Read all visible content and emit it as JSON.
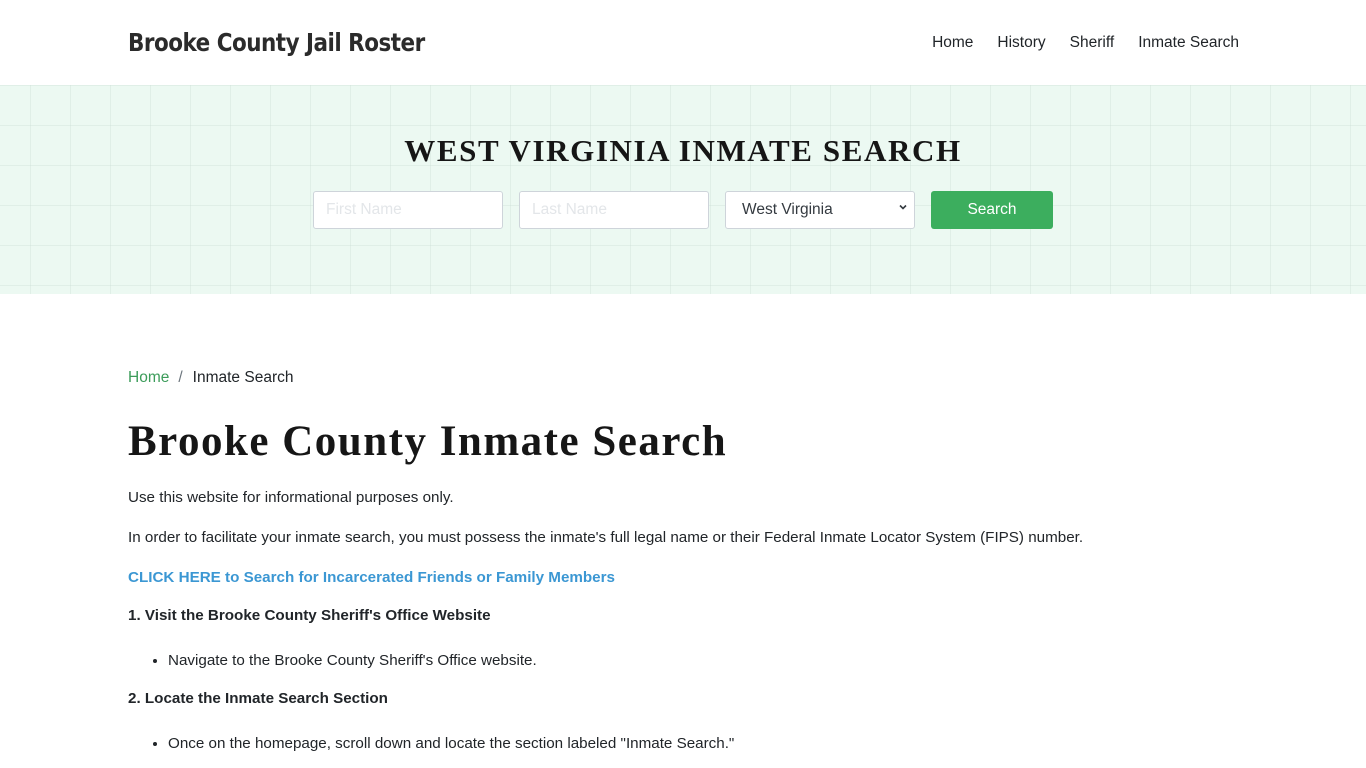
{
  "header": {
    "brand": "Brooke County Jail Roster",
    "nav": [
      {
        "label": "Home"
      },
      {
        "label": "History"
      },
      {
        "label": "Sheriff"
      },
      {
        "label": "Inmate Search"
      }
    ]
  },
  "hero": {
    "title": "WEST VIRGINIA INMATE SEARCH",
    "first_name_placeholder": "First Name",
    "first_name_value": "",
    "last_name_placeholder": "Last Name",
    "last_name_value": "",
    "state_selected": "West Virginia",
    "search_label": "Search",
    "colors": {
      "background": "#ecf9f2",
      "button": "#3cae5e"
    }
  },
  "breadcrumb": {
    "home": "Home",
    "separator": "/",
    "current": "Inmate Search"
  },
  "main": {
    "title": "Brooke County Inmate Search",
    "intro": "Use this website for informational purposes only.",
    "requirement": "In order to facilitate your inmate search, you must possess the inmate's full legal name or their Federal Inmate Locator System (FIPS) number.",
    "cta_link": "CLICK HERE to Search for Incarcerated Friends or Family Members",
    "steps": [
      {
        "heading": "1. Visit the Brooke County Sheriff's Office Website",
        "bullets": [
          "Navigate to the Brooke County Sheriff's Office website."
        ]
      },
      {
        "heading": "2. Locate the Inmate Search Section",
        "bullets": [
          "Once on the homepage, scroll down and locate the section labeled \"Inmate Search.\""
        ]
      }
    ],
    "colors": {
      "link": "#3b97d3",
      "breadcrumb_link": "#3c9c5a"
    }
  }
}
